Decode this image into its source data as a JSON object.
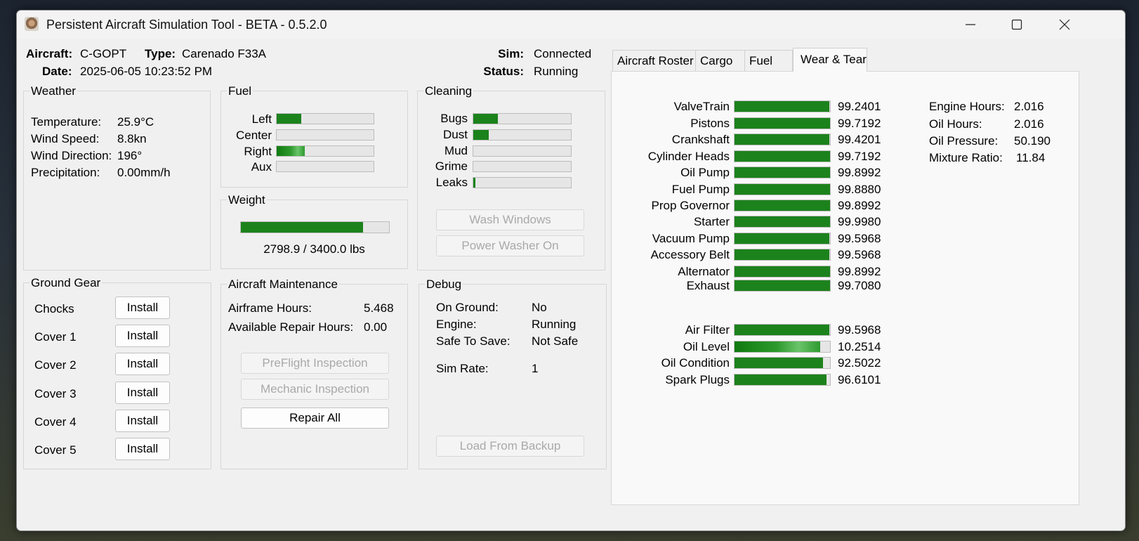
{
  "window": {
    "title": "Persistent Aircraft Simulation Tool - BETA - 0.5.2.0"
  },
  "header": {
    "aircraft_label": "Aircraft:",
    "aircraft_value": "C-GOPT",
    "type_label": "Type:",
    "type_value": "Carenado F33A",
    "date_label": "Date:",
    "date_value": "2025-06-05 10:23:52 PM",
    "sim_label": "Sim:",
    "sim_value": "Connected",
    "status_label": "Status:",
    "status_value": "Running"
  },
  "weather": {
    "title": "Weather",
    "rows": [
      {
        "label": "Temperature:",
        "value": "25.9°C"
      },
      {
        "label": "Wind Speed:",
        "value": "8.8kn"
      },
      {
        "label": "Wind Direction:",
        "value": "196°"
      },
      {
        "label": "Precipitation:",
        "value": "0.00mm/h"
      }
    ]
  },
  "fuel": {
    "title": "Fuel",
    "tanks": [
      {
        "label": "Left",
        "level": 0.25
      },
      {
        "label": "Center",
        "level": 0.0
      },
      {
        "label": "Right",
        "level": 0.29
      },
      {
        "label": "Aux",
        "level": 0.0
      }
    ]
  },
  "cleaning": {
    "title": "Cleaning",
    "items": [
      {
        "label": "Bugs",
        "level": 0.25
      },
      {
        "label": "Dust",
        "level": 0.16
      },
      {
        "label": "Mud",
        "level": 0.0
      },
      {
        "label": "Grime",
        "level": 0.0
      },
      {
        "label": "Leaks",
        "level": 0.02
      }
    ],
    "wash_button": "Wash Windows",
    "power_washer_button": "Power Washer On"
  },
  "weight": {
    "title": "Weight",
    "level": 0.823,
    "text": "2798.9 / 3400.0 lbs"
  },
  "ground_gear": {
    "title": "Ground Gear",
    "items": [
      {
        "label": "Chocks",
        "button": "Install"
      },
      {
        "label": "Cover 1",
        "button": "Install"
      },
      {
        "label": "Cover 2",
        "button": "Install"
      },
      {
        "label": "Cover 3",
        "button": "Install"
      },
      {
        "label": "Cover 4",
        "button": "Install"
      },
      {
        "label": "Cover 5",
        "button": "Install"
      }
    ]
  },
  "maintenance": {
    "title": "Aircraft Maintenance",
    "airframe_label": "Airframe Hours:",
    "airframe_value": "5.468",
    "repair_label": "Available Repair Hours:",
    "repair_value": "0.00",
    "preflight_button": "PreFlight Inspection",
    "mechanic_button": "Mechanic Inspection",
    "repair_all_button": "Repair All"
  },
  "debug": {
    "title": "Debug",
    "rows": [
      {
        "label": "On Ground:",
        "value": "No"
      },
      {
        "label": "Engine:",
        "value": "Running"
      },
      {
        "label": "Safe To Save:",
        "value": "Not Safe"
      },
      {
        "label": "Sim Rate:",
        "value": "1"
      }
    ],
    "load_backup_button": "Load From Backup"
  },
  "tabs": [
    "Aircraft Roster",
    "Cargo",
    "Fuel",
    "Wear & Tear"
  ],
  "active_tab": "Wear & Tear",
  "wear": {
    "components": [
      {
        "label": "ValveTrain",
        "value": "99.2401",
        "level": 0.992
      },
      {
        "label": "Pistons",
        "value": "99.7192",
        "level": 0.997
      },
      {
        "label": "Crankshaft",
        "value": "99.4201",
        "level": 0.994
      },
      {
        "label": "Cylinder Heads",
        "value": "99.7192",
        "level": 0.997
      },
      {
        "label": "Oil Pump",
        "value": "99.8992",
        "level": 0.999
      },
      {
        "label": "Fuel Pump",
        "value": "99.8880",
        "level": 0.999
      },
      {
        "label": "Prop Governor",
        "value": "99.8992",
        "level": 0.999
      },
      {
        "label": "Starter",
        "value": "99.9980",
        "level": 1.0
      },
      {
        "label": "Vacuum Pump",
        "value": "99.5968",
        "level": 0.996
      },
      {
        "label": "Accessory Belt",
        "value": "99.5968",
        "level": 0.996
      },
      {
        "label": "Alternator",
        "value": "99.8992",
        "level": 0.999
      },
      {
        "label": "Exhaust",
        "value": "99.7080",
        "level": 0.997
      }
    ],
    "consumables": [
      {
        "label": "Air Filter",
        "value": "99.5968",
        "level": 0.996
      },
      {
        "label": "Oil Level",
        "value": "10.2514",
        "level": 0.9
      },
      {
        "label": "Oil Condition",
        "value": "92.5022",
        "level": 0.925
      },
      {
        "label": "Spark Plugs",
        "value": "96.6101",
        "level": 0.966
      }
    ],
    "stats": [
      {
        "label": "Engine Hours:",
        "value": "2.016"
      },
      {
        "label": "Oil Hours:",
        "value": "2.016"
      },
      {
        "label": "Oil Pressure:",
        "value": "50.190"
      },
      {
        "label": "Mixture Ratio:",
        "value": "11.84"
      }
    ]
  }
}
